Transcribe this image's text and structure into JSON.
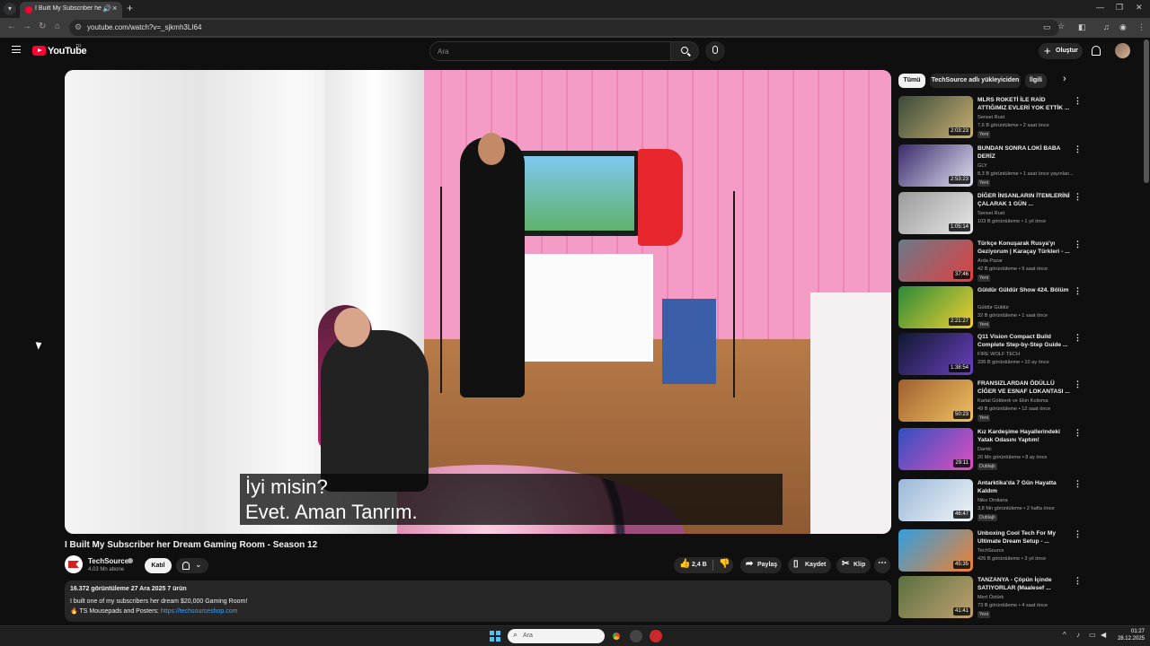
{
  "browser": {
    "tab_title": "I Built My Subscriber her Dr",
    "url": "youtube.com/watch?v=_sjkmh3LI64"
  },
  "masthead": {
    "logo_text": "YouTube",
    "region": "TR",
    "search_placeholder": "Ara",
    "create_label": "Oluştur"
  },
  "player": {
    "subtitle_line1": "İyi misin?",
    "subtitle_line2": "Evet.  Aman Tanrım."
  },
  "video": {
    "title": "I Built My Subscriber her Dream Gaming Room - Season 12",
    "channel": "TechSource",
    "subscribers": "4,03 Mn abone",
    "join_label": "Katıl",
    "likes": "2,4 B",
    "share_label": "Paylaş",
    "save_label": "Kaydet",
    "clip_label": "Klip",
    "description": {
      "meta": "16.372 görüntüleme  27 Ara 2025  7 ürün",
      "line1": "I built one of my subscribers her dream $20,000 Gaming Room!",
      "line2_prefix": "🔥 TS Mousepads and Posters: ",
      "line2_link": "https://techsourceshop.com"
    }
  },
  "chips": [
    "Tümü",
    "TechSource adlı yükleyiciden",
    "İlgili"
  ],
  "recommendations": [
    {
      "title": "MLRS ROKETİ İLE RAİD ATTIĞIMIZ EVLERİ YOK ETTİK ...",
      "channel": "Sensei Rust",
      "meta": "7,6 B görüntüleme • 2 saat önce",
      "badge": "Yeni",
      "duration": "2:03:23",
      "thumb_colors": [
        "#3a4a3a",
        "#c8b070"
      ]
    },
    {
      "title": "BUNDAN SONRA LOKİ BABA DERİZ",
      "channel": "GLY",
      "meta": "8,3 B görüntüleme • 1 saat önce yayınlan...",
      "badge": "Yeni",
      "duration": "2:53:23",
      "thumb_colors": [
        "#3b2a6a",
        "#e0e0f0"
      ]
    },
    {
      "title": "DİĞER İNSANLARIN İTEMLERİNİ ÇALARAK 1 GÜN ...",
      "channel": "Sensei Rust",
      "meta": "103 B görüntüleme • 1 yıl önce",
      "badge": "",
      "duration": "1:05:14",
      "thumb_colors": [
        "#9a9a9a",
        "#e8e8e8"
      ]
    },
    {
      "title": "Türkçe Konuşarak Rusya'yı Geziyorum | Karaçay Türkleri - ...",
      "channel": "Arda Pazar",
      "meta": "42 B görüntüleme • 9 saat önce",
      "badge": "Yeni",
      "duration": "37:46",
      "thumb_colors": [
        "#6a7a8a",
        "#e04040"
      ]
    },
    {
      "title": "Güldür Güldür Show 424. Bölüm",
      "channel": "Güldür Güldür",
      "meta": "32 B görüntüleme • 1 saat önce",
      "badge": "Yeni",
      "duration": "2:21:27",
      "thumb_colors": [
        "#2a8a3a",
        "#f0d030"
      ]
    },
    {
      "title": "Q11 Vision Compact Build Complete Step-by-Step Guide ...",
      "channel": "FIRE WOLF TECH",
      "meta": "336 B görüntüleme • 10 ay önce",
      "badge": "",
      "duration": "1:38:54",
      "thumb_colors": [
        "#101830",
        "#6a40c0"
      ]
    },
    {
      "title": "FRANSIZLARDAN ÖDÜLLÜ CİĞER VE ESNAF LOKANTASI ...",
      "channel": "Kartal Gökberk ve Ekin Kolisma",
      "meta": "49 B görüntüleme • 12 saat önce",
      "badge": "Yeni",
      "duration": "50:23",
      "thumb_colors": [
        "#a06030",
        "#f0c060"
      ]
    },
    {
      "title": "Kız Kardeşime Hayallerindeki Yatak Odasını Yaptım!",
      "channel": "Dantic",
      "meta": "20 Mn görüntüleme • 8 ay önce",
      "badge": "Dublajlı",
      "duration": "29:11",
      "thumb_colors": [
        "#3050c0",
        "#e050c0"
      ]
    },
    {
      "title": "Antarktika'da 7 Gün Hayatta Kaldım",
      "channel": "Niko Omilana",
      "meta": "3,8 Mn görüntüleme • 2 hafta önce",
      "badge": "Dublajlı",
      "duration": "46:47",
      "thumb_colors": [
        "#9ab8d8",
        "#f0f4f8"
      ]
    },
    {
      "title": "Unboxing Cool Tech For My Ultimate Dream Setup - ...",
      "channel": "TechSource",
      "meta": "426 B görüntüleme • 3 yıl önce",
      "badge": "",
      "duration": "45:35",
      "thumb_colors": [
        "#30a0e0",
        "#f08030"
      ]
    },
    {
      "title": "TANZANYA - Çöpün İçinde SATIYORLAR (Maalesef ...",
      "channel": "Mert Öztürk",
      "meta": "73 B görüntüleme • 4 saat önce",
      "badge": "Yeni",
      "duration": "41:41",
      "thumb_colors": [
        "#5a7040",
        "#c0a070"
      ]
    }
  ],
  "taskbar": {
    "search_label": "Ara",
    "time": "01:27",
    "date": "28.12.2025"
  }
}
